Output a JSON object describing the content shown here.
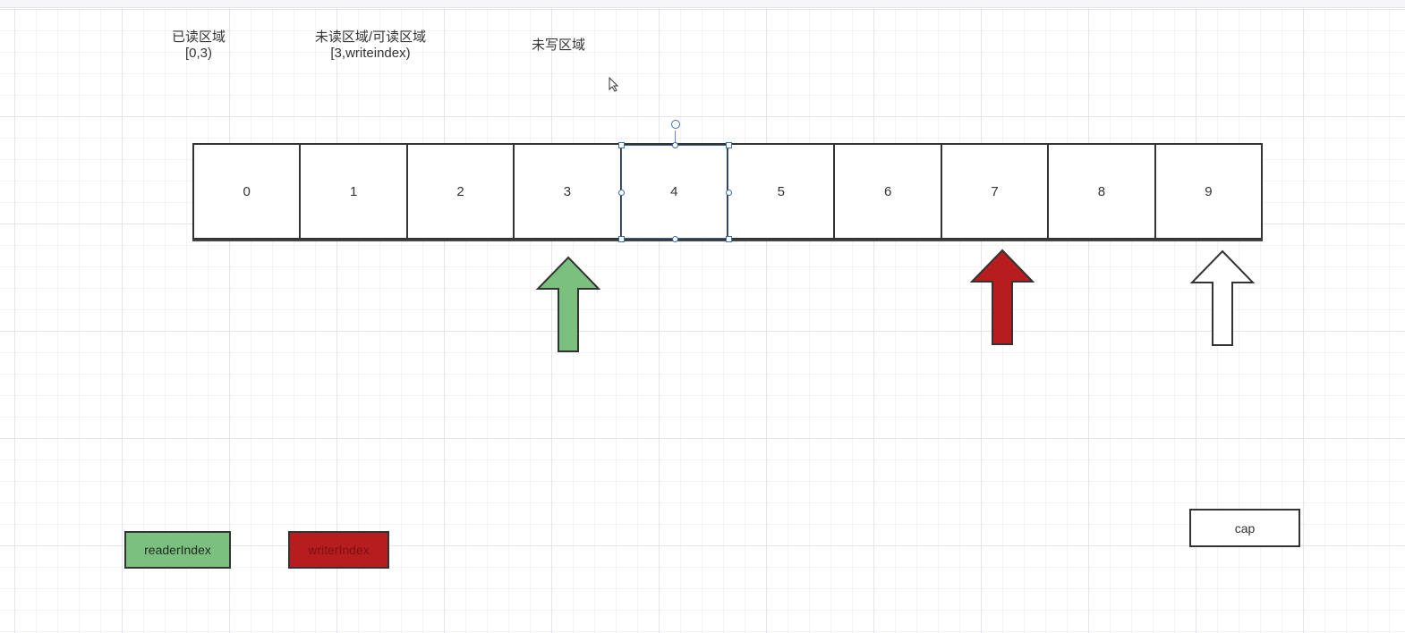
{
  "labels": {
    "read_region": "已读区域",
    "read_range": "[0,3)",
    "unread_region": "未读区域/可读区域",
    "unread_range": "[3,writeindex)",
    "unwritten_region": "未写区域"
  },
  "cells": [
    "0",
    "1",
    "2",
    "3",
    "4",
    "5",
    "6",
    "7",
    "8",
    "9"
  ],
  "selected_cell": "4",
  "legend": {
    "reader": "readerIndex",
    "writer": "writerIndex",
    "cap": "cap"
  },
  "colors": {
    "reader": "#7cc07f",
    "writer": "#b71c1f",
    "cap": "#ffffff",
    "selection": "#3b6fa8"
  },
  "icons": {
    "reader_pointer": "up-arrow-icon",
    "writer_pointer": "up-arrow-icon",
    "cap_pointer": "up-arrow-icon",
    "cursor": "mouse-pointer-icon"
  }
}
